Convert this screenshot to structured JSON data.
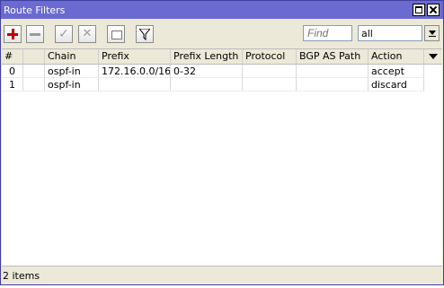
{
  "window": {
    "title": "Route Filters"
  },
  "toolbar": {
    "find_placeholder": "Find",
    "filter_value": "all"
  },
  "table": {
    "columns": [
      "#",
      "",
      "Chain",
      "Prefix",
      "Prefix Length",
      "Protocol",
      "BGP AS Path",
      "Action"
    ],
    "rows": [
      {
        "num": "0",
        "flag": "",
        "chain": "ospf-in",
        "prefix": "172.16.0.0/16",
        "prefix_length": "0-32",
        "protocol": "",
        "bgp_as_path": "",
        "action": "accept"
      },
      {
        "num": "1",
        "flag": "",
        "chain": "ospf-in",
        "prefix": "",
        "prefix_length": "",
        "protocol": "",
        "bgp_as_path": "",
        "action": "discard"
      }
    ]
  },
  "status": {
    "text": "2 items"
  },
  "icons": [
    "add-icon",
    "remove-icon",
    "enable-icon",
    "disable-icon",
    "comment-icon",
    "filter-icon",
    "maximize-icon",
    "close-icon",
    "dropdown-arrow-icon",
    "column-menu-icon"
  ],
  "colors": {
    "titlebar": "#6a6ad0",
    "add": "#c00000"
  }
}
